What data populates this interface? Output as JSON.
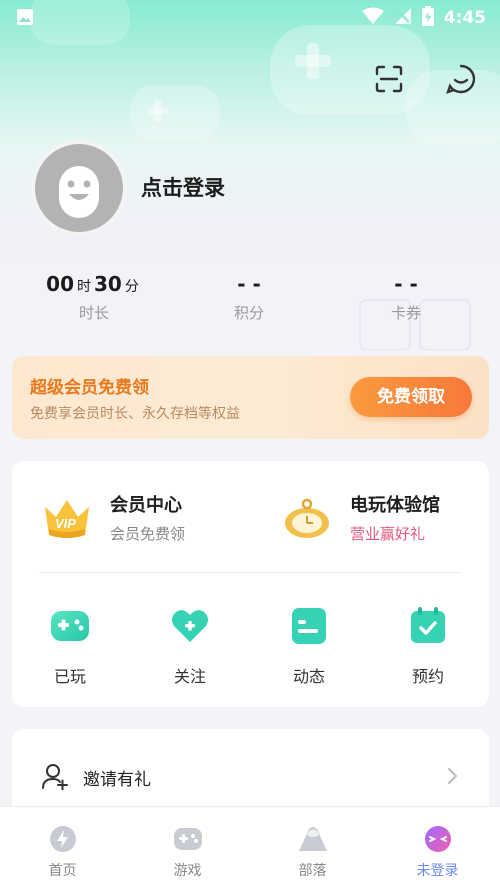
{
  "status_bar": {
    "time": "4:45"
  },
  "profile": {
    "login_prompt": "点击登录"
  },
  "stats": [
    {
      "value_h": "00",
      "unit_h": "时",
      "value_m": "30",
      "unit_m": "分",
      "label": "时长"
    },
    {
      "value": "- -",
      "label": "积分"
    },
    {
      "value": "- -",
      "label": "卡券"
    }
  ],
  "vip_banner": {
    "title": "超级会员免费领",
    "subtitle": "免费享会员时长、永久存档等权益",
    "button": "免费领取"
  },
  "features": [
    {
      "title": "会员中心",
      "subtitle": "会员免费领",
      "subtitle_color": "#888888",
      "icon": "vip-crown-icon"
    },
    {
      "title": "电玩体验馆",
      "subtitle": "营业赢好礼",
      "subtitle_color": "#e8577e",
      "icon": "pocket-watch-icon"
    }
  ],
  "quick_actions": [
    {
      "label": "已玩",
      "icon": "gamepad-icon"
    },
    {
      "label": "关注",
      "icon": "heart-icon"
    },
    {
      "label": "动态",
      "icon": "post-icon"
    },
    {
      "label": "预约",
      "icon": "calendar-check-icon"
    }
  ],
  "invite": {
    "label": "邀请有礼"
  },
  "bottom_nav": [
    {
      "label": "首页",
      "icon": "home-bolt-icon",
      "active": false
    },
    {
      "label": "游戏",
      "icon": "gamepad-icon",
      "active": false
    },
    {
      "label": "部落",
      "icon": "tribe-mountain-icon",
      "active": false
    },
    {
      "label": "未登录",
      "icon": "smile-face-icon",
      "active": true
    }
  ],
  "colors": {
    "accent": "#3dd6b3",
    "orange": "#f7793a",
    "active_nav": "#6b8cf6"
  }
}
